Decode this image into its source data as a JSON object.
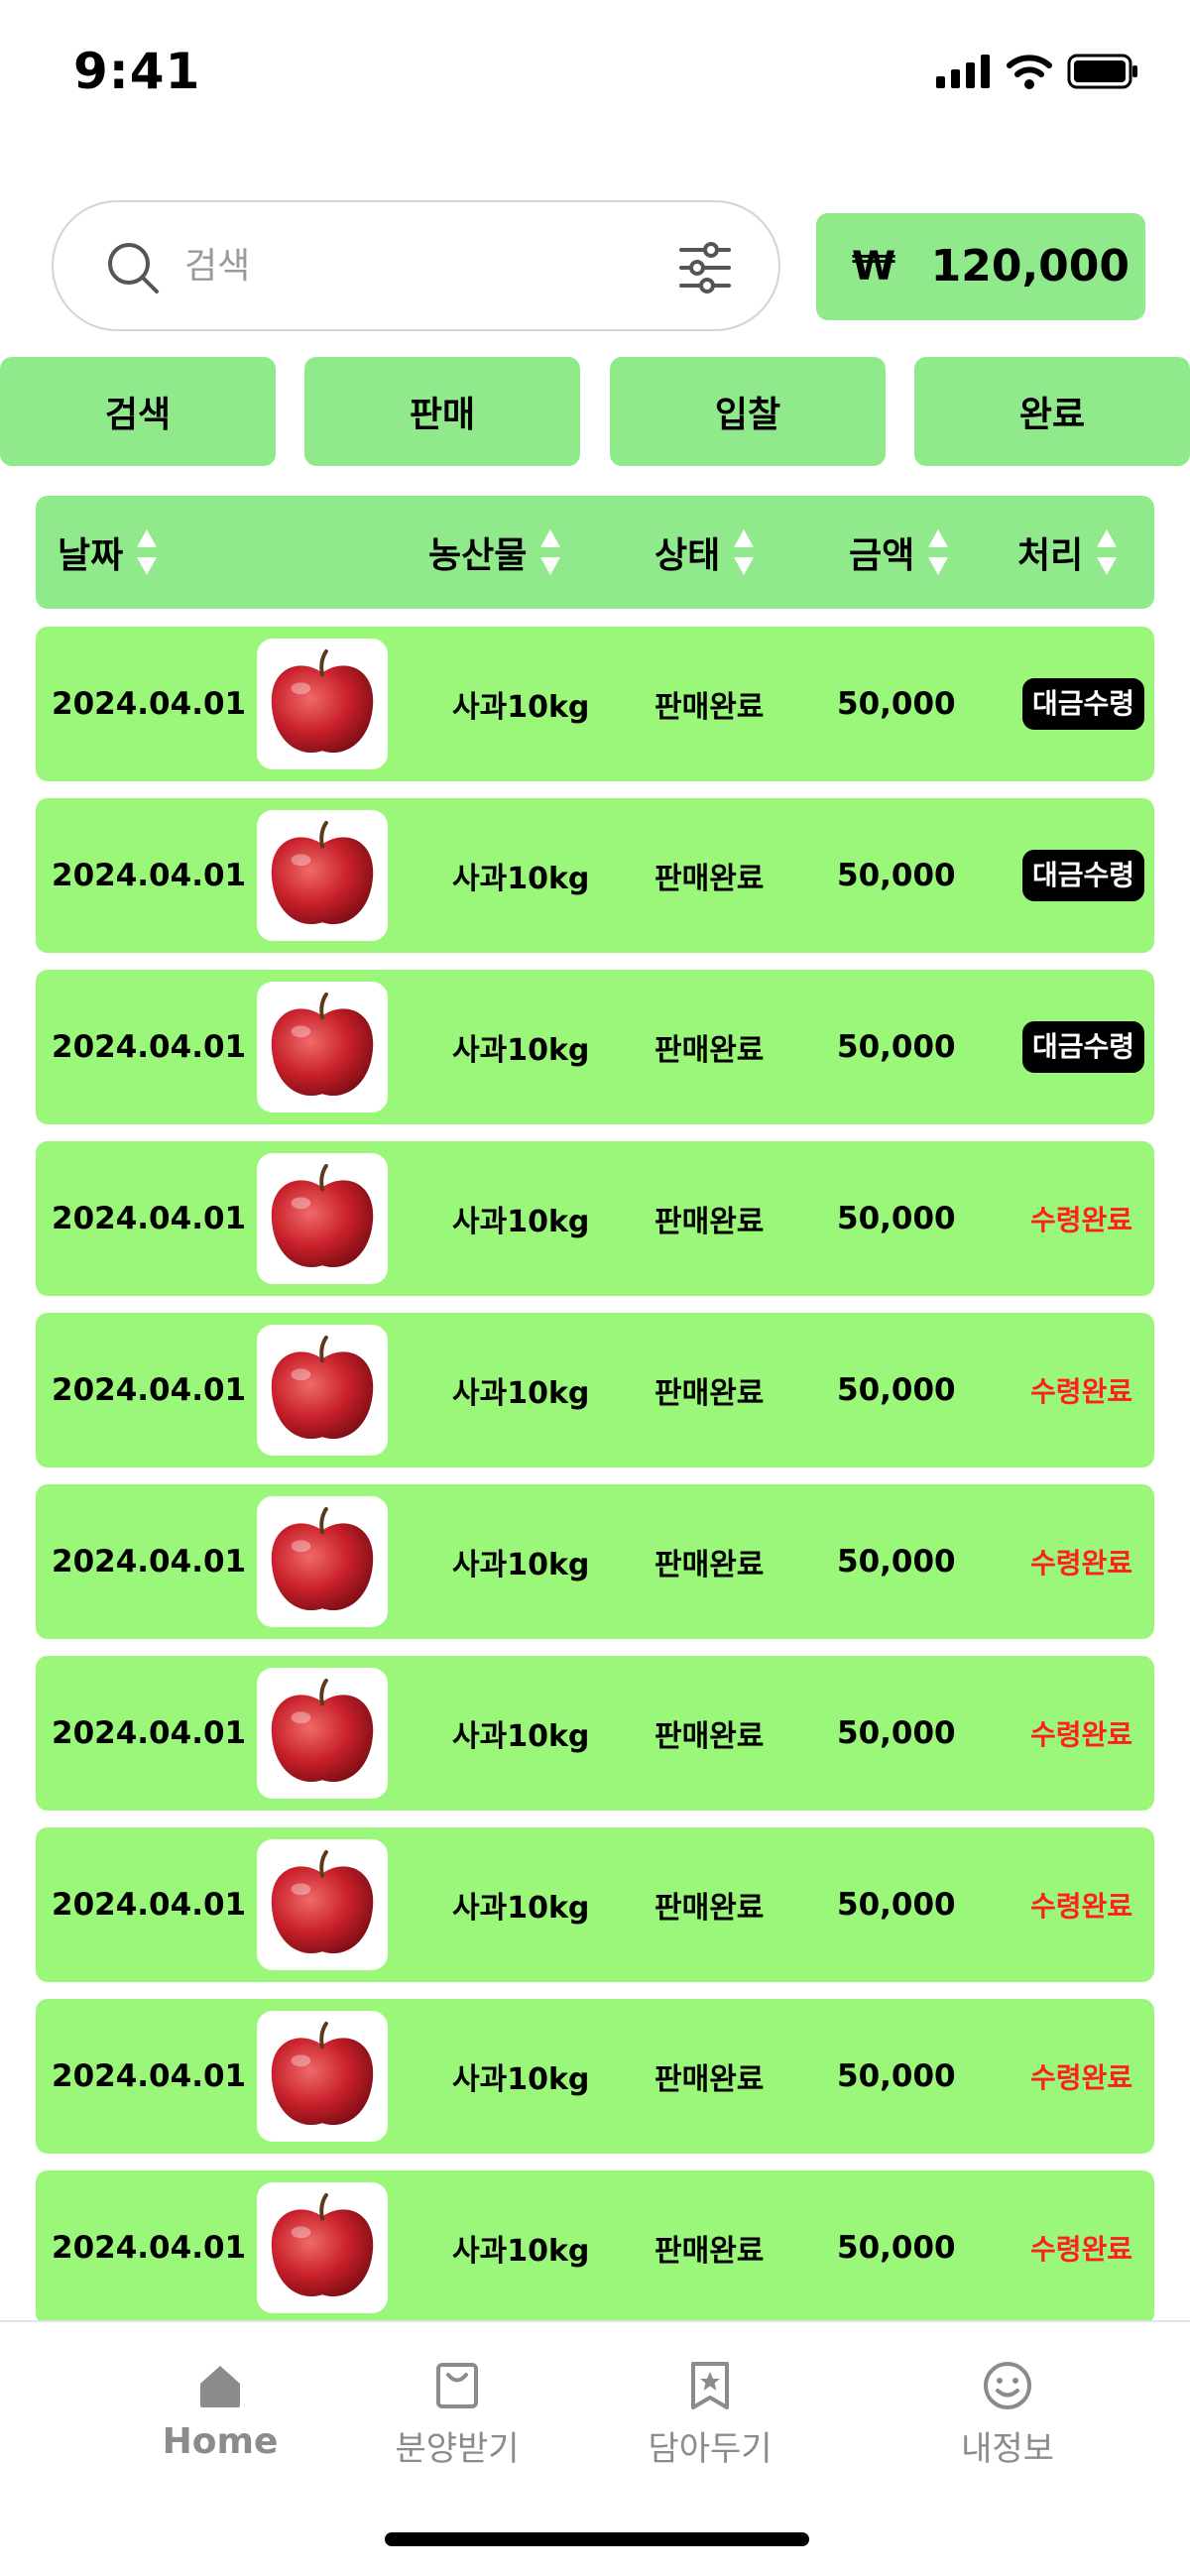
{
  "status_bar": {
    "time": "9:41"
  },
  "search": {
    "placeholder": "검색"
  },
  "balance": {
    "currency_symbol": "₩",
    "amount": "120,000"
  },
  "tabs": [
    {
      "label": "검색"
    },
    {
      "label": "판매"
    },
    {
      "label": "입찰"
    },
    {
      "label": "완료"
    }
  ],
  "table": {
    "headers": {
      "date": "날짜",
      "product": "농산물",
      "status": "상태",
      "amount": "금액",
      "action": "처리"
    },
    "rows": [
      {
        "date": "2024.04.01",
        "product": "사과10kg",
        "status": "판매완료",
        "amount": "50,000",
        "action": "대금수령"
      },
      {
        "date": "2024.04.01",
        "product": "사과10kg",
        "status": "판매완료",
        "amount": "50,000",
        "action": "대금수령"
      },
      {
        "date": "2024.04.01",
        "product": "사과10kg",
        "status": "판매완료",
        "amount": "50,000",
        "action": "대금수령"
      },
      {
        "date": "2024.04.01",
        "product": "사과10kg",
        "status": "판매완료",
        "amount": "50,000",
        "action": "수령완료"
      },
      {
        "date": "2024.04.01",
        "product": "사과10kg",
        "status": "판매완료",
        "amount": "50,000",
        "action": "수령완료"
      },
      {
        "date": "2024.04.01",
        "product": "사과10kg",
        "status": "판매완료",
        "amount": "50,000",
        "action": "수령완료"
      },
      {
        "date": "2024.04.01",
        "product": "사과10kg",
        "status": "판매완료",
        "amount": "50,000",
        "action": "수령완료"
      },
      {
        "date": "2024.04.01",
        "product": "사과10kg",
        "status": "판매완료",
        "amount": "50,000",
        "action": "수령완료"
      },
      {
        "date": "2024.04.01",
        "product": "사과10kg",
        "status": "판매완료",
        "amount": "50,000",
        "action": "수령완료"
      },
      {
        "date": "2024.04.01",
        "product": "사과10kg",
        "status": "판매완료",
        "amount": "50,000",
        "action": "수령완료"
      }
    ]
  },
  "bottom_nav": {
    "items": [
      {
        "label": "Home",
        "icon": "home-icon"
      },
      {
        "label": "분양받기",
        "icon": "bag-icon"
      },
      {
        "label": "담아두기",
        "icon": "bookmark-star-icon"
      },
      {
        "label": "내정보",
        "icon": "smile-icon"
      }
    ]
  },
  "colors": {
    "accent_green": "#90ea8c",
    "row_green": "#9af77a",
    "done_red": "#ff1f1f",
    "badge_black": "#000000"
  }
}
